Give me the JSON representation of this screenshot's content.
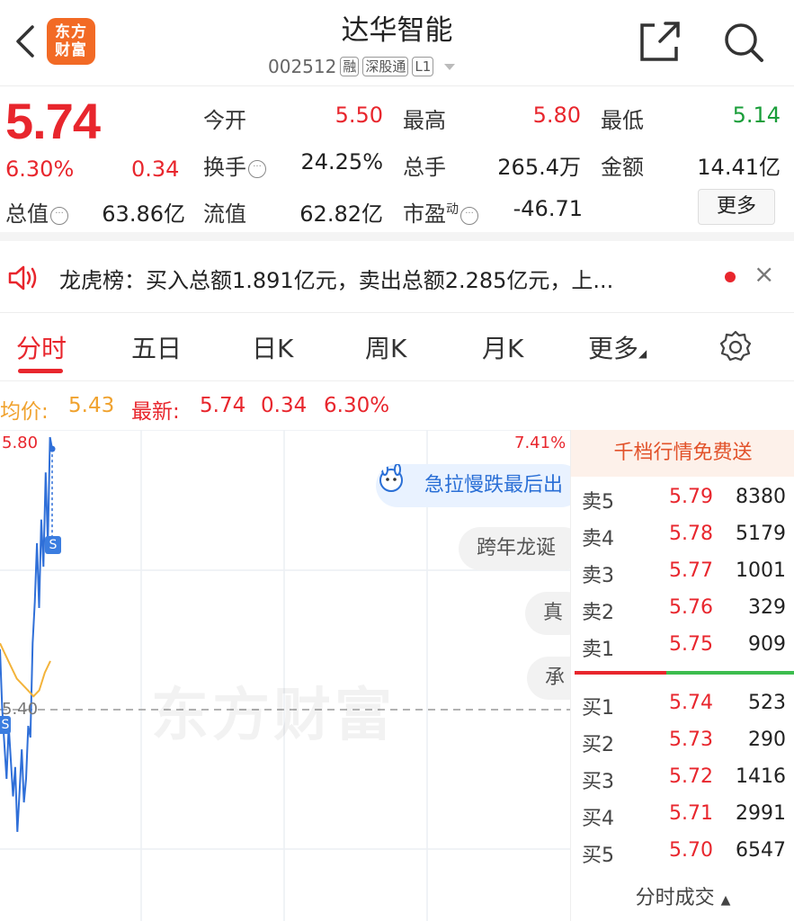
{
  "header": {
    "title": "达华智能",
    "code": "002512",
    "tags": [
      "融",
      "深股通",
      "L1"
    ],
    "logo_text": "东方\n财富",
    "icons": [
      "back-icon",
      "share-icon",
      "search-icon"
    ]
  },
  "quote": {
    "price": "5.74",
    "pct": "6.30%",
    "change": "0.34",
    "rows": [
      [
        {
          "label": "今开",
          "value": "5.50",
          "color": "red"
        },
        {
          "label": "最高",
          "value": "5.80",
          "color": "red"
        },
        {
          "label": "最低",
          "value": "5.14",
          "color": "green"
        }
      ],
      [
        {
          "label": "换手",
          "value": "24.25%",
          "color": "dark",
          "info": true
        },
        {
          "label": "总手",
          "value": "265.4万",
          "color": "dark"
        },
        {
          "label": "金额",
          "value": "14.41亿",
          "color": "dark"
        }
      ],
      [
        {
          "label": "流值",
          "value": "62.82亿",
          "color": "dark"
        },
        {
          "label": "市盈",
          "sup": "动",
          "value": "-46.71",
          "color": "dark",
          "info": true
        }
      ]
    ],
    "total_value_label": "总值",
    "total_value": "63.86亿",
    "more_label": "更多"
  },
  "notice": {
    "text": "龙虎榜：买入总额1.891亿元，卖出总额2.285亿元，上...",
    "close": "×"
  },
  "tabs": {
    "items": [
      "分时",
      "五日",
      "日K",
      "周K",
      "月K",
      "更多"
    ],
    "active": 0
  },
  "avg": {
    "avg_label": "均价:",
    "avg_value": "5.43",
    "latest_label": "最新:",
    "latest_price": "5.74",
    "latest_change": "0.34",
    "latest_pct": "6.30%"
  },
  "chart": {
    "top_price": "5.80",
    "mid_price": "5.40",
    "top_pct": "7.41%",
    "watermark": "东方财富",
    "marker": "S",
    "pills": [
      "急拉慢跌最后出",
      "跨年龙诞",
      "真",
      "承"
    ]
  },
  "chart_data": {
    "type": "line",
    "ylim": [
      5.0,
      5.8
    ],
    "series": [
      {
        "values": [
          5.44,
          5.34,
          5.28,
          5.22,
          5.31,
          5.25,
          5.19,
          5.24,
          5.13,
          5.2,
          5.27,
          5.18,
          5.22,
          5.31,
          5.29,
          5.45,
          5.52,
          5.62,
          5.51,
          5.66,
          5.58,
          5.74,
          5.62,
          5.8,
          5.78
        ]
      },
      {
        "values": [
          5.45,
          5.43,
          5.41,
          5.39,
          5.38,
          5.37,
          5.36,
          5.37,
          5.4,
          5.42
        ]
      }
    ]
  },
  "book": {
    "title": "千档行情免费送",
    "asks": [
      {
        "label": "卖5",
        "price": "5.79",
        "vol": "8380"
      },
      {
        "label": "卖4",
        "price": "5.78",
        "vol": "5179"
      },
      {
        "label": "卖3",
        "price": "5.77",
        "vol": "1001"
      },
      {
        "label": "卖2",
        "price": "5.76",
        "vol": "329"
      },
      {
        "label": "卖1",
        "price": "5.75",
        "vol": "909"
      }
    ],
    "bids": [
      {
        "label": "买1",
        "price": "5.74",
        "vol": "523"
      },
      {
        "label": "买2",
        "price": "5.73",
        "vol": "290"
      },
      {
        "label": "买3",
        "price": "5.72",
        "vol": "1416"
      },
      {
        "label": "买4",
        "price": "5.71",
        "vol": "2991"
      },
      {
        "label": "买5",
        "price": "5.70",
        "vol": "6547"
      }
    ],
    "footer": "分时成交"
  }
}
